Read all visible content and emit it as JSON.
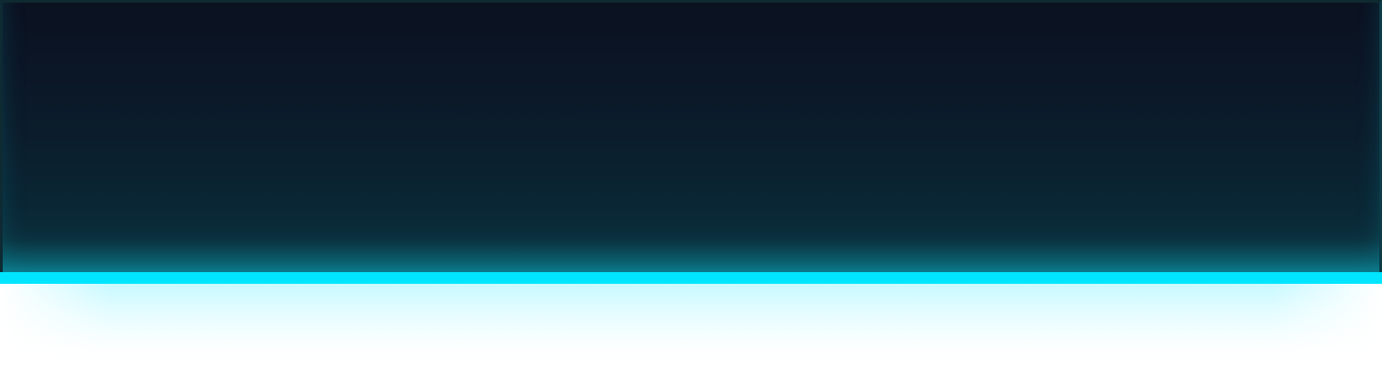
{
  "colors": {
    "page_background": "#ffffff",
    "panel_top": "#0b1120",
    "panel_bottom": "#0f5563",
    "accent": "#00e5ff"
  },
  "hero": {
    "title": "",
    "subtitle": ""
  }
}
